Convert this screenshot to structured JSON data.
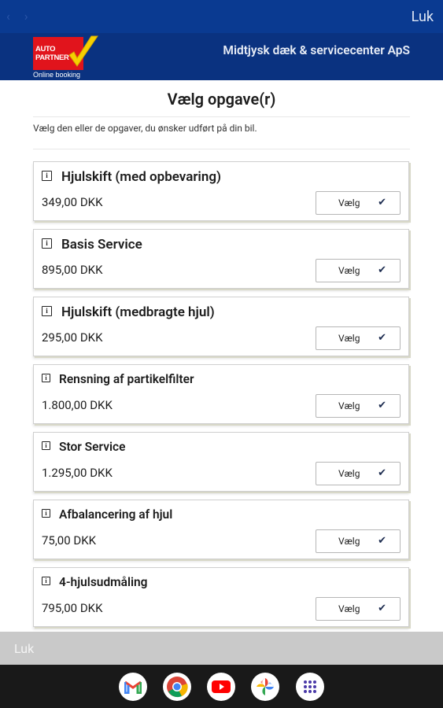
{
  "topbar": {
    "back": "‹",
    "forward": "›",
    "close_label": "Luk"
  },
  "brand": {
    "logo_line1": "AUTO",
    "logo_line2": "PARTNER",
    "logo_tagline": "Online booking",
    "company": "Midtjysk dæk & servicecenter ApS"
  },
  "page": {
    "title": "Vælg opgave(r)",
    "subtitle": "Vælg den eller de opgaver, du ønsker udført på din bil."
  },
  "tasks": [
    {
      "name": "Hjulskift (med opbevaring)",
      "price": "349,00 DKK",
      "button": "Vælg"
    },
    {
      "name": "Basis Service",
      "price": "895,00 DKK",
      "button": "Vælg"
    },
    {
      "name": "Hjulskift (medbragte hjul)",
      "price": "295,00 DKK",
      "button": "Vælg"
    },
    {
      "name": "Rensning af partikelfilter",
      "price": "1.800,00 DKK",
      "button": "Vælg"
    },
    {
      "name": "Stor Service",
      "price": "1.295,00 DKK",
      "button": "Vælg"
    },
    {
      "name": "Afbalancering af hjul",
      "price": "75,00 DKK",
      "button": "Vælg"
    },
    {
      "name": "4-hjulsudmåling",
      "price": "795,00 DKK",
      "button": "Vælg"
    }
  ],
  "footer": {
    "close_label": "Luk"
  },
  "dock": {
    "apps": [
      "gmail-icon",
      "chrome-icon",
      "youtube-icon",
      "photos-icon",
      "app-drawer-icon"
    ]
  },
  "colors": {
    "header_bg": "#0a3a91",
    "brand_bg": "#0a3280",
    "logo_red": "#e1141c",
    "check_yellow": "#f5d000"
  }
}
